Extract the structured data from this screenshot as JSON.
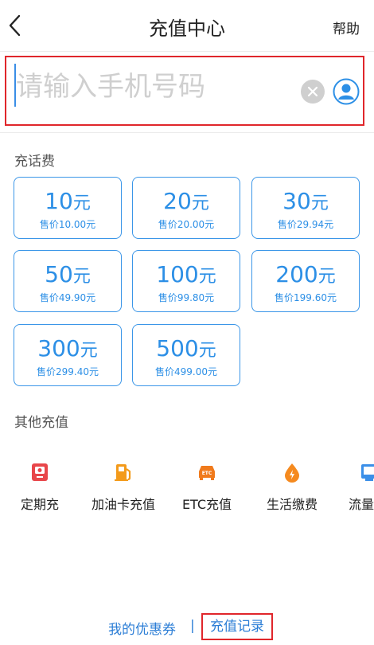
{
  "header": {
    "title": "充值中心",
    "help_label": "帮助"
  },
  "phone": {
    "placeholder": "请输入手机号码",
    "value": ""
  },
  "recharge": {
    "section_title": "充话费",
    "unit": "元",
    "options": [
      {
        "amount": "10",
        "price": "售价10.00元"
      },
      {
        "amount": "20",
        "price": "售价20.00元"
      },
      {
        "amount": "30",
        "price": "售价29.94元"
      },
      {
        "amount": "50",
        "price": "售价49.90元"
      },
      {
        "amount": "100",
        "price": "售价99.80元"
      },
      {
        "amount": "200",
        "price": "售价199.60元"
      },
      {
        "amount": "300",
        "price": "售价299.40元"
      },
      {
        "amount": "500",
        "price": "售价499.00元"
      }
    ]
  },
  "other": {
    "section_title": "其他充值",
    "items": [
      {
        "label": "定期充",
        "icon": "calendar-icon",
        "color": "#e8464a"
      },
      {
        "label": "加油卡充值",
        "icon": "fuel-pump-icon",
        "color": "#f39a1a"
      },
      {
        "label": "ETC充值",
        "icon": "etc-car-icon",
        "color": "#f07a1c"
      },
      {
        "label": "生活缴费",
        "icon": "drop-bolt-icon",
        "color": "#f58a1f"
      },
      {
        "label": "流量",
        "icon": "data-traffic-icon",
        "color": "#3b8fe8"
      }
    ]
  },
  "footer": {
    "coupon_label": "我的优惠券",
    "separator": "|",
    "record_label": "充值记录"
  },
  "colors": {
    "accent": "#2c8fe6",
    "highlight": "#e0262b"
  }
}
